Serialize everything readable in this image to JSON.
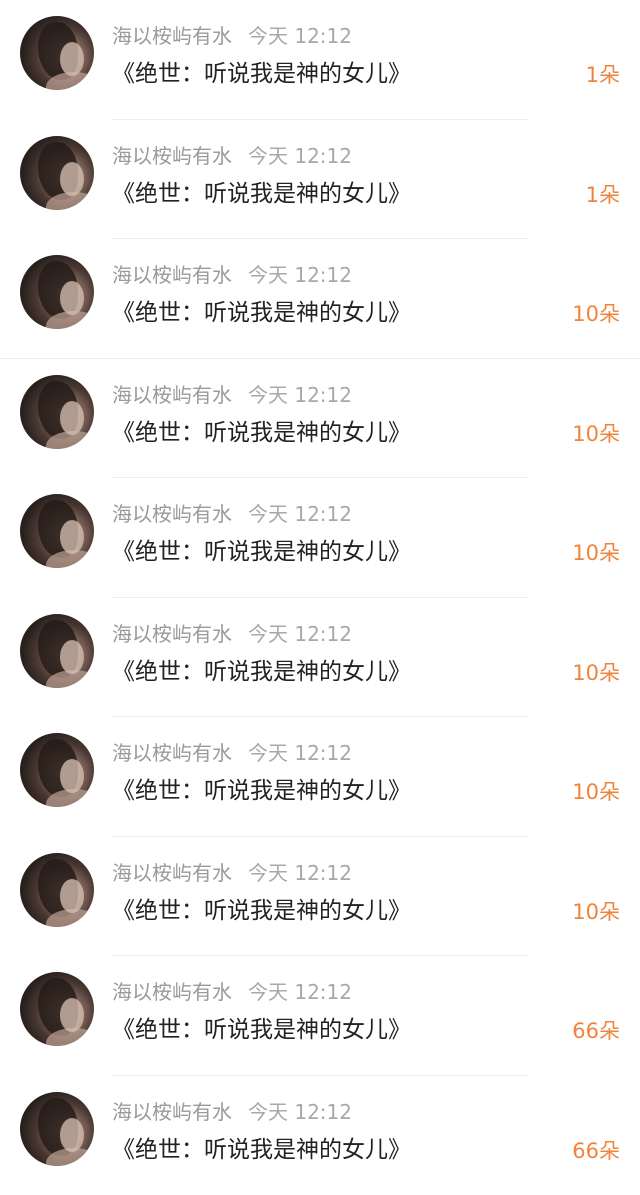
{
  "items": [
    {
      "author": "海以桉屿有水",
      "time": "今天 12:12",
      "title": "《绝世：听说我是神的女儿》",
      "count": "1朵"
    },
    {
      "author": "海以桉屿有水",
      "time": "今天 12:12",
      "title": "《绝世：听说我是神的女儿》",
      "count": "1朵"
    },
    {
      "author": "海以桉屿有水",
      "time": "今天 12:12",
      "title": "《绝世：听说我是神的女儿》",
      "count": "10朵"
    },
    {
      "author": "海以桉屿有水",
      "time": "今天 12:12",
      "title": "《绝世：听说我是神的女儿》",
      "count": "10朵"
    },
    {
      "author": "海以桉屿有水",
      "time": "今天 12:12",
      "title": "《绝世：听说我是神的女儿》",
      "count": "10朵"
    },
    {
      "author": "海以桉屿有水",
      "time": "今天 12:12",
      "title": "《绝世：听说我是神的女儿》",
      "count": "10朵"
    },
    {
      "author": "海以桉屿有水",
      "time": "今天 12:12",
      "title": "《绝世：听说我是神的女儿》",
      "count": "10朵"
    },
    {
      "author": "海以桉屿有水",
      "time": "今天 12:12",
      "title": "《绝世：听说我是神的女儿》",
      "count": "10朵"
    },
    {
      "author": "海以桉屿有水",
      "time": "今天 12:12",
      "title": "《绝世：听说我是神的女儿》",
      "count": "66朵"
    },
    {
      "author": "海以桉屿有水",
      "time": "今天 12:12",
      "title": "《绝世：听说我是神的女儿》",
      "count": "66朵"
    }
  ],
  "colors": {
    "accent": "#f0843c",
    "meta": "#9a9a9a",
    "title": "#222222",
    "divider": "#eeeeee"
  }
}
